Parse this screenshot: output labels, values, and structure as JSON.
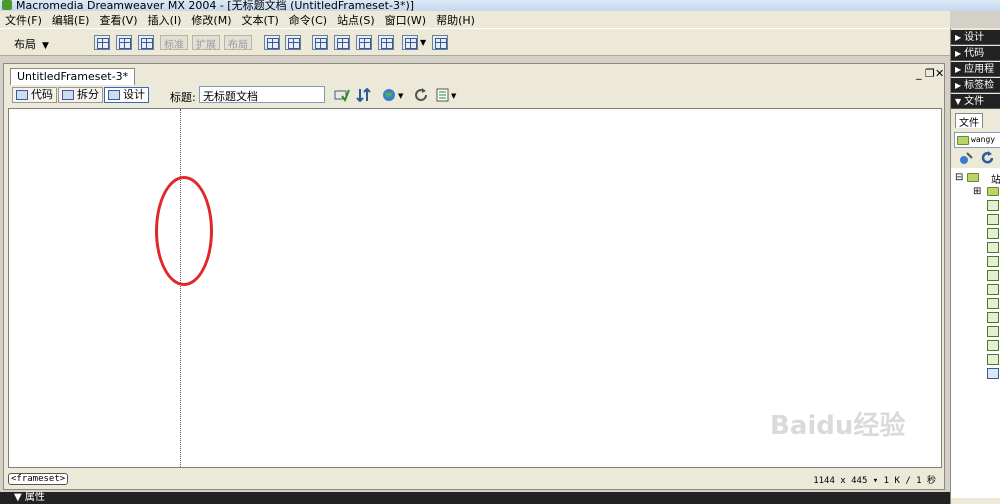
{
  "window": {
    "title": "Macromedia Dreamweaver MX 2004 - [无标题文档 (UntitledFrameset-3*)]"
  },
  "menu": [
    "文件(F)",
    "编辑(E)",
    "查看(V)",
    "插入(I)",
    "修改(M)",
    "文本(T)",
    "命令(C)",
    "站点(S)",
    "窗口(W)",
    "帮助(H)"
  ],
  "insert_bar": {
    "category": "布局",
    "modes": [
      "标准",
      "扩展",
      "布局"
    ]
  },
  "document": {
    "tab_label": "UntitledFrameset-3*",
    "views": {
      "code": "代码",
      "split": "拆分",
      "design": "设计"
    },
    "active_view": "design",
    "title_label": "标题:",
    "title_value": "无标题文档"
  },
  "status": {
    "tag": "<frameset>",
    "info": "1144 x 445 ▾ 1 K / 1 秒"
  },
  "properties": {
    "label": "▼ 属性"
  },
  "panels": {
    "design": "设计",
    "code": "代码",
    "application": "应用程",
    "tag": "标签检",
    "files": "文件",
    "files_tab": "文件",
    "site": "wangy",
    "site_root": "站"
  },
  "watermark": "Baidu经验",
  "colors": {
    "annotation": "#e0282b",
    "panel_header": "#222222"
  }
}
